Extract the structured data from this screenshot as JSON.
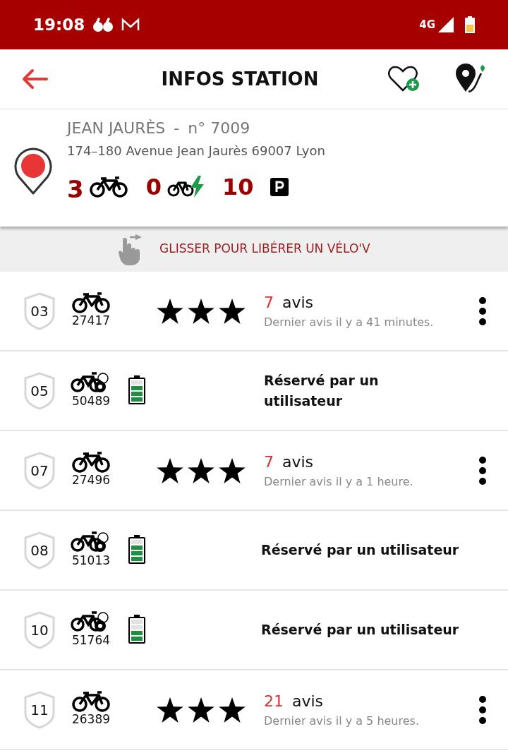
{
  "status_bar": {
    "time": "19:08",
    "network": "4G"
  },
  "header": {
    "title": "INFOS STATION"
  },
  "station": {
    "name": "JEAN JAURÈS",
    "separator": "-",
    "number": "n° 7009",
    "address": "174–180 Avenue Jean Jaurès 69007 Lyon",
    "bikes": "3",
    "ebikes": "0",
    "docks": "10"
  },
  "hint": {
    "text": "GLISSER POUR LIBÉRER UN VÉLO'V"
  },
  "bikes": [
    {
      "kind": "rated",
      "dock": "03",
      "id": "27417",
      "stars": 3,
      "reviews_count": "7",
      "reviews_label": "avis",
      "last_review": "Dernier avis il y a 41 minutes."
    },
    {
      "kind": "reserved",
      "dock": "05",
      "id": "50489",
      "battery_reduced": false,
      "status": "Réservé par un utilisateur",
      "wrap": true
    },
    {
      "kind": "rated",
      "dock": "07",
      "id": "27496",
      "stars": 3,
      "reviews_count": "7",
      "reviews_label": "avis",
      "last_review": "Dernier avis il y a 1 heure."
    },
    {
      "kind": "reserved",
      "dock": "08",
      "id": "51013",
      "battery_reduced": false,
      "status": "Réservé par un utilisateur",
      "wrap": false
    },
    {
      "kind": "reserved",
      "dock": "10",
      "id": "51764",
      "battery_reduced": true,
      "status": "Réservé par un utilisateur",
      "wrap": false
    },
    {
      "kind": "rated",
      "dock": "11",
      "id": "26389",
      "stars": 3,
      "reviews_count": "21",
      "reviews_label": "avis",
      "last_review": "Dernier avis il y a 5 heures."
    }
  ]
}
